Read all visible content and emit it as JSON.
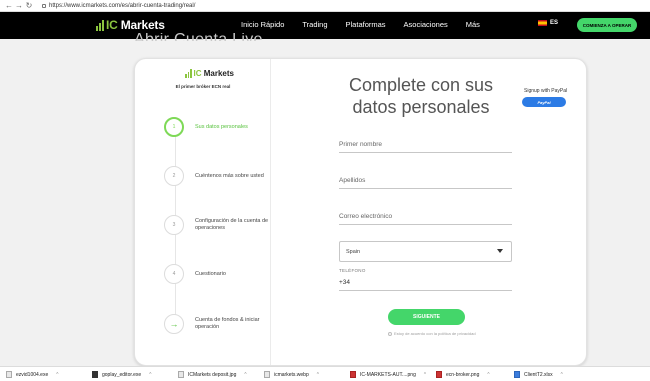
{
  "browser": {
    "back": "←",
    "forward": "→",
    "reload": "↻",
    "url": "https://www.icmarkets.com/es/abrir-cuenta-trading/real/"
  },
  "header": {
    "logo_text": "Markets",
    "menu": [
      "Inicio Rápido",
      "Trading",
      "Plataformas",
      "Asociaciones",
      "Más"
    ],
    "language": "ES",
    "cta": "COMIENZA A OPERAR"
  },
  "background_title": "Abrir Cuenta Live",
  "sidebar": {
    "logo_text": "Markets",
    "tagline": "El primer bróker ECN real",
    "steps": [
      {
        "number": "1",
        "label": "Sus datos personales",
        "active": true
      },
      {
        "number": "2",
        "label": "Cuéntenos más sobre usted",
        "active": false
      },
      {
        "number": "3",
        "label": "Configuración de la cuenta de operaciones",
        "active": false
      },
      {
        "number": "4",
        "label": "Cuestionario",
        "active": false
      },
      {
        "number": "→",
        "label": "Cuenta de fondos & iniciar operación",
        "active": false
      }
    ]
  },
  "form": {
    "heading": "Complete con sus datos personales",
    "paypal_label": "Signup with PayPal",
    "paypal_button": "PayPal",
    "first_name_placeholder": "Primer nombre",
    "last_name_placeholder": "Apellidos",
    "email_placeholder": "Correo electrónico",
    "country_value": "Spain",
    "phone_label": "TELÉFONO",
    "phone_value": "+34",
    "submit": "SIGUIENTE",
    "policy_text": "Estoy de acuerdo con la política de privacidad"
  },
  "downloads": [
    {
      "name": "ezvid1004.exe",
      "type": "exe"
    },
    {
      "name": "goplay_editor.exe",
      "type": "exe-dark"
    },
    {
      "name": "ICMarkets deposit.jpg",
      "type": "image"
    },
    {
      "name": "icmarkets.webp",
      "type": "image"
    },
    {
      "name": "IC-MARKETS-AUT....png",
      "type": "png-red"
    },
    {
      "name": "ecn-broker.png",
      "type": "png-red"
    },
    {
      "name": "ClientT2.xlsx",
      "type": "xlsx"
    }
  ]
}
